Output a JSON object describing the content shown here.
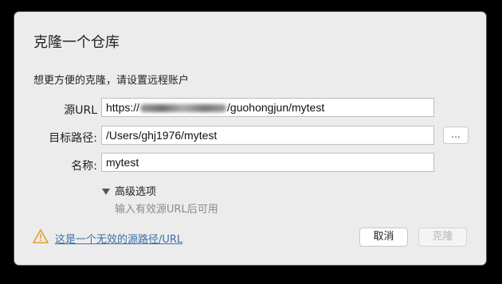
{
  "dialog": {
    "title": "克隆一个仓库",
    "subtitle": "想更方便的克隆，请设置远程账户"
  },
  "form": {
    "source_label": "源URL",
    "source_prefix": "https://",
    "source_suffix": "/guohongjun/mytest",
    "path_label": "目标路径:",
    "path_value": "/Users/ghj1976/mytest",
    "browse_label": "...",
    "name_label": "名称:",
    "name_value": "mytest"
  },
  "advanced": {
    "label": "高级选项",
    "hint": "输入有效源URL后可用"
  },
  "footer": {
    "warning_text": "这是一个无效的源路径/URL",
    "cancel_label": "取消",
    "clone_label": "克隆"
  },
  "colors": {
    "dialog_bg": "#ececec",
    "link": "#3d6fa8",
    "warning": "#e0a030"
  }
}
